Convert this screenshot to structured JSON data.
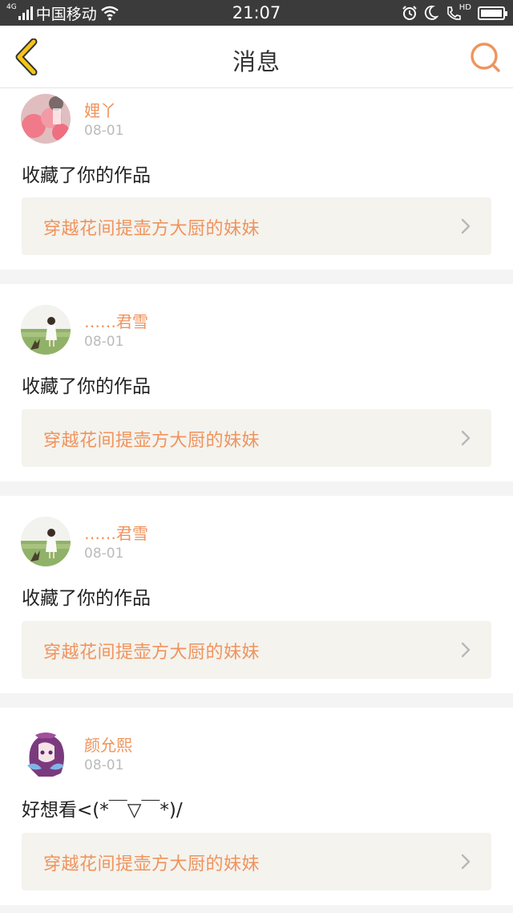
{
  "status_bar": {
    "network_type": "4G",
    "carrier": "中国移动",
    "time": "21:07",
    "hd_label": "HD",
    "icons": [
      "signal-icon",
      "wifi-icon",
      "alarm-icon",
      "moon-icon",
      "call-icon",
      "battery-icon"
    ]
  },
  "navbar": {
    "back_icon": "chevron-left-icon",
    "title": "消息",
    "search_icon": "search-icon"
  },
  "messages": [
    {
      "user": "娌丫",
      "date": "08-01",
      "text": "收藏了你的作品",
      "work_title": "穿越花间提壶方大厨的妹妹",
      "avatar": "pink-balloon-avatar"
    },
    {
      "user": "……君雪",
      "date": "08-01",
      "text": "收藏了你的作品",
      "work_title": "穿越花间提壶方大厨的妹妹",
      "avatar": "girl-field-avatar"
    },
    {
      "user": "……君雪",
      "date": "08-01",
      "text": "收藏了你的作品",
      "work_title": "穿越花间提壶方大厨的妹妹",
      "avatar": "girl-field-avatar"
    },
    {
      "user": "颜允熙",
      "date": "08-01",
      "text": "好想看<(*￣▽￣*)/",
      "work_title": "穿越花间提壶方大厨的妹妹",
      "avatar": "anime-girl-avatar"
    }
  ],
  "colors": {
    "accent": "#f0935c",
    "back_icon": "#f5c518",
    "status_bar": "#3b3b3b",
    "work_box": "#f4f3ee"
  }
}
